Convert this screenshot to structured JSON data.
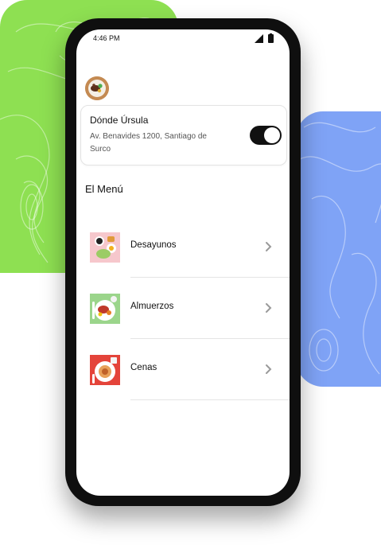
{
  "status_bar": {
    "time": "4:46 PM"
  },
  "restaurant": {
    "name": "Dónde Úrsula",
    "address": "Av. Benavides 1200, Santiago de Surco",
    "toggle_on": true
  },
  "menu": {
    "title": "El Menú",
    "items": [
      {
        "label": "Desayunos",
        "thumb_bg": "#f6c7cc"
      },
      {
        "label": "Almuerzos",
        "thumb_bg": "#9bd58b"
      },
      {
        "label": "Cenas",
        "thumb_bg": "#e4443a"
      }
    ]
  },
  "colors": {
    "green_blob": "#8ee052",
    "blue_blob": "#7fa3f6",
    "phone_frame": "#0f0f0f",
    "toggle": "#111111"
  }
}
